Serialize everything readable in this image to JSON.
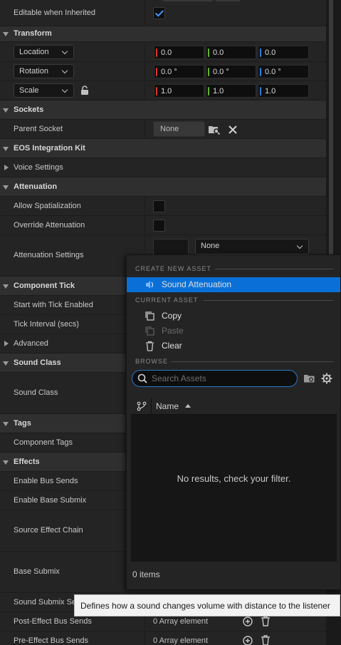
{
  "rows": {
    "editable_when_inherited": "Editable when Inherited",
    "transform": "Transform",
    "location": "Location",
    "rotation": "Rotation",
    "scale": "Scale",
    "location_vals": [
      "0.0",
      "0.0",
      "0.0"
    ],
    "rotation_vals": [
      "0.0 °",
      "0.0 °",
      "0.0 °"
    ],
    "scale_vals": [
      "1.0",
      "1.0",
      "1.0"
    ],
    "sockets": "Sockets",
    "parent_socket": "Parent Socket",
    "parent_socket_value": "None",
    "eos_integration_kit": "EOS Integration Kit",
    "voice_settings": "Voice Settings",
    "attenuation": "Attenuation",
    "allow_spatialization": "Allow Spatialization",
    "override_attenuation": "Override Attenuation",
    "attenuation_settings": "Attenuation Settings",
    "attenuation_settings_value": "None",
    "component_tick": "Component Tick",
    "start_with_tick_enabled": "Start with Tick Enabled",
    "tick_interval": "Tick Interval (secs)",
    "advanced": "Advanced",
    "sound_class_cat": "Sound Class",
    "sound_class": "Sound Class",
    "tags": "Tags",
    "component_tags": "Component Tags",
    "effects": "Effects",
    "enable_bus_sends": "Enable Bus Sends",
    "enable_base_submix": "Enable Base Submix",
    "source_effect_chain": "Source Effect Chain",
    "base_submix": "Base Submix",
    "sound_submix_sends": "Sound Submix Se",
    "post_effect_bus_sends": "Post-Effect Bus Sends",
    "pre_effect_bus_sends": "Pre-Effect Bus Sends",
    "array_element": "0 Array element"
  },
  "popup": {
    "create_new_asset": "CREATE NEW ASSET",
    "sound_attenuation": "Sound Attenuation",
    "current_asset": "CURRENT ASSET",
    "copy": "Copy",
    "paste": "Paste",
    "clear": "Clear",
    "browse": "BROWSE",
    "search_placeholder": "Search Assets",
    "column_name": "Name",
    "empty_message": "No results, check your filter.",
    "item_count": "0 items"
  },
  "tooltip": "Defines how a sound changes volume with distance to the listener",
  "colors": {
    "accent": "#0a70d8",
    "x_axis": "#e0362f",
    "y_axis": "#5fb52e",
    "z_axis": "#2f7fe0",
    "checkbox_check": "#3d9bff"
  }
}
